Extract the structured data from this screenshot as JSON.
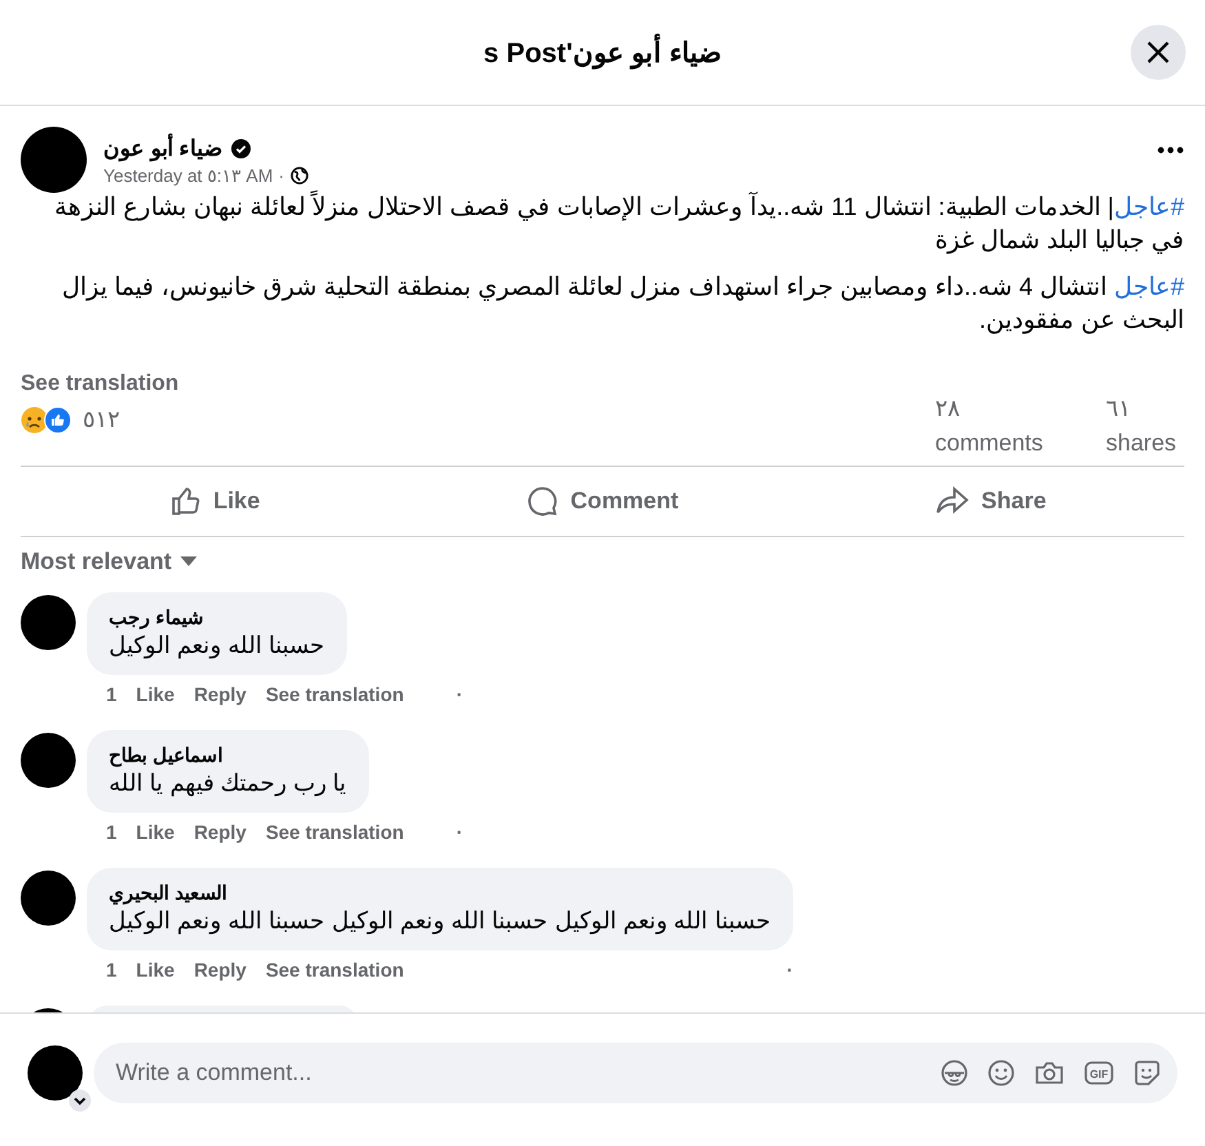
{
  "window": {
    "title": "ضياء أبو عون's Post"
  },
  "post": {
    "author": "ضياء أبو عون",
    "verified": true,
    "time": "Yesterday at ٥:١٣ AM",
    "separator": "·",
    "paragraphs": [
      {
        "hashtag": "#عاجل",
        "text": "| الخدمات الطبية: انتشال 11 شه..يدآ وعشرات الإصابات في قصف الاحتلال منزلاً لعائلة نبهان بشارع النزهة في جباليا البلد شمال غزة"
      },
      {
        "hashtag": "#عاجل",
        "text": " انتشال 4 شه..داء ومصابين جراء استهداف منزل لعائلة المصري بمنطقة التحلية شرق خانيونس، فيما يزال البحث عن مفقودين."
      }
    ],
    "see_translation": "See translation",
    "reaction_count": "٥١٢",
    "comments_count": "٢٨ comments",
    "shares_count": "٦١ shares",
    "actions": {
      "like": "Like",
      "comment": "Comment",
      "share": "Share"
    }
  },
  "sort": {
    "label": "Most relevant"
  },
  "comments": [
    {
      "name": "شيماء رجب",
      "text": "حسبنا الله ونعم الوكيل",
      "reactions": "1",
      "like": "Like",
      "reply": "Reply",
      "translate": "See translation",
      "dot": "·"
    },
    {
      "name": "اسماعيل بطاح",
      "text": "يا رب رحمتك فيهم يا الله",
      "reactions": "1",
      "like": "Like",
      "reply": "Reply",
      "translate": "See translation",
      "dot": "·"
    },
    {
      "name": "السعيد البحيري",
      "text": "حسبنا الله ونعم الوكيل حسبنا الله ونعم الوكيل حسبنا الله ونعم الوكيل",
      "reactions": "1",
      "like": "Like",
      "reply": "Reply",
      "translate": "See translation",
      "dot": "·"
    }
  ],
  "composer": {
    "placeholder": "Write a comment...",
    "gif_label": "GIF"
  }
}
